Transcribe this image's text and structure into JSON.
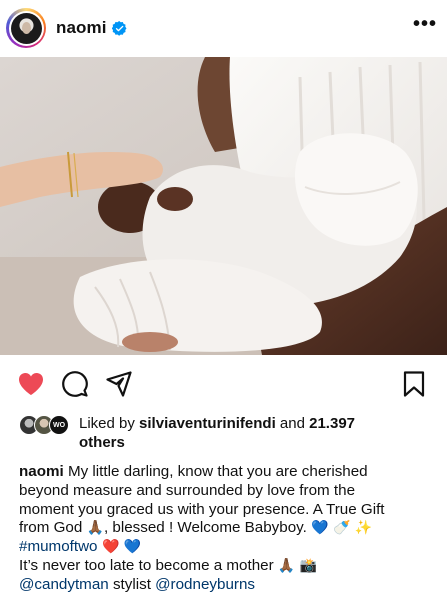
{
  "post": {
    "username": "naomi",
    "verified_icon": "verified-badge-icon",
    "more_icon": "more-horizontal-icon",
    "more_label": "•••"
  },
  "photo": {
    "description_icon": "photo-newborn-hands",
    "colors": {
      "background": "#d9d2cc",
      "skin_dark": "#5a3324",
      "skin_light": "#e2b79b",
      "fabric": "#f3f1ef"
    }
  },
  "actions": {
    "like_icon": "heart-filled-icon",
    "like_color": "#ed4956",
    "comment_icon": "comment-icon",
    "share_icon": "paper-plane-icon",
    "save_icon": "bookmark-icon"
  },
  "likes": {
    "prefix": "Liked by ",
    "top_liker": "silviaventurinifendi",
    "middle": " and ",
    "count": "21.397",
    "count_line2": "others",
    "liker_badge": "WO"
  },
  "caption": {
    "author": "naomi",
    "line1": " My little darling, know that you are cherished",
    "line2": "beyond measure and surrounded by love from the",
    "line3": "moment you graced us with your presence. A True Gift",
    "line4a": "from God ",
    "emoji_pray": "🙏🏾",
    "line4b": ", blessed ! Welcome Babyboy. ",
    "emoji_line4_end": "💙 🍼 ✨",
    "hashtag": "#mumoftwo",
    "emoji_hearts": " ❤️ 💙",
    "line6a": " It’s never too late to become a mother ",
    "emoji_line6_end": "🙏🏾 📸",
    "mention1": "@candytman",
    "line7_mid": "  stylist ",
    "mention2": "@rodneyburns"
  }
}
